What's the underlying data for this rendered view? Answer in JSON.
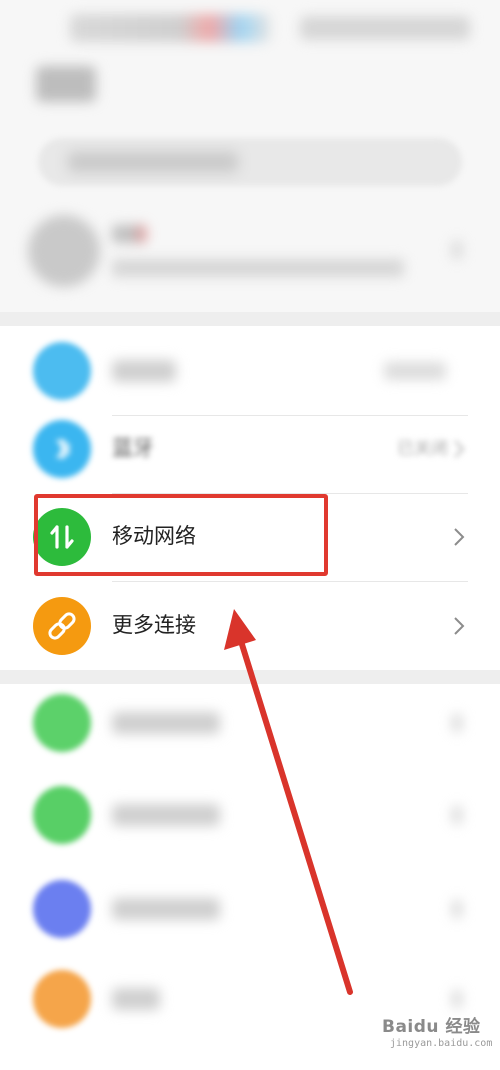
{
  "settings_list": {
    "bluetooth": {
      "label": "蓝牙",
      "value": "已关闭",
      "icon": "bluetooth-icon",
      "icon_color": "#3bb6f0"
    },
    "mobile_network": {
      "label": "移动网络",
      "icon": "mobile-data-icon",
      "icon_color": "#2dbb3c"
    },
    "more_connections": {
      "label": "更多连接",
      "icon": "link-icon",
      "icon_color": "#f59a10"
    }
  },
  "annotation": {
    "highlight_color": "#e0392f",
    "arrow_color": "#d9342b"
  },
  "watermark": {
    "brand": "Baidu 经验",
    "url": "jingyan.baidu.com"
  }
}
